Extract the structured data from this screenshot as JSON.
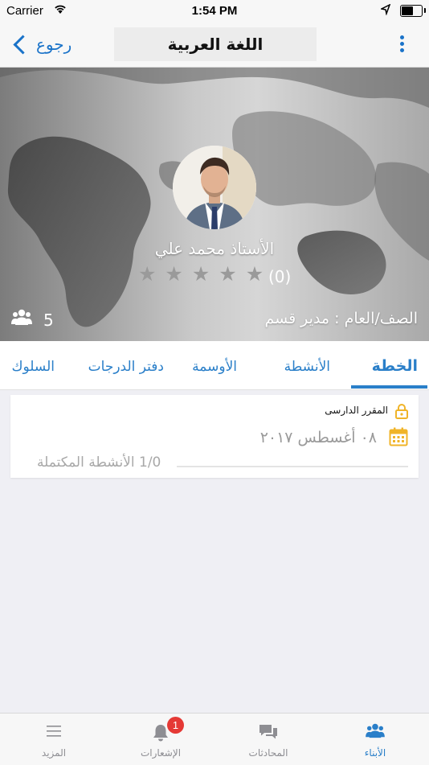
{
  "status_bar": {
    "carrier": "Carrier",
    "time": "1:54 PM"
  },
  "nav": {
    "back_label": "رجوع",
    "title": "اللغة العربية"
  },
  "teacher": {
    "name": "الأستاذ محمد علي",
    "rating_count": "(0)",
    "stars_filled": 0,
    "stars_total": 5,
    "class_info": "الصف/العام : مدير قسم",
    "students_count": "5"
  },
  "tabs": [
    {
      "label": "الخطة",
      "active": true
    },
    {
      "label": "الأنشطة",
      "active": false
    },
    {
      "label": "الأوسمة",
      "active": false
    },
    {
      "label": "دفتر الدرجات",
      "active": false
    },
    {
      "label": "السلوك",
      "active": false
    }
  ],
  "plan_card": {
    "course_label": "المقرر الدارسى",
    "date": "٠٨ أغسطس ٢٠١٧",
    "progress_text": "1/0 الأنشطة المكتملة",
    "progress_fraction": 0
  },
  "tab_bar": {
    "children": "الأبناء",
    "conversations": "المحادثات",
    "notifications": "الإشعارات",
    "notifications_badge": "1",
    "more": "المزيد"
  },
  "colors": {
    "accent": "#2a7fc9",
    "badge": "#e53935",
    "star_empty": "#9a9a9a",
    "lock": "#f0b429"
  },
  "icons": {
    "tab_children": "people-icon",
    "tab_conversations": "chat-bubbles-icon",
    "tab_notifications": "bell-icon",
    "tab_more": "hamburger-menu-icon",
    "students": "people-icon",
    "course": "lock-icon",
    "date": "calendar-icon"
  }
}
